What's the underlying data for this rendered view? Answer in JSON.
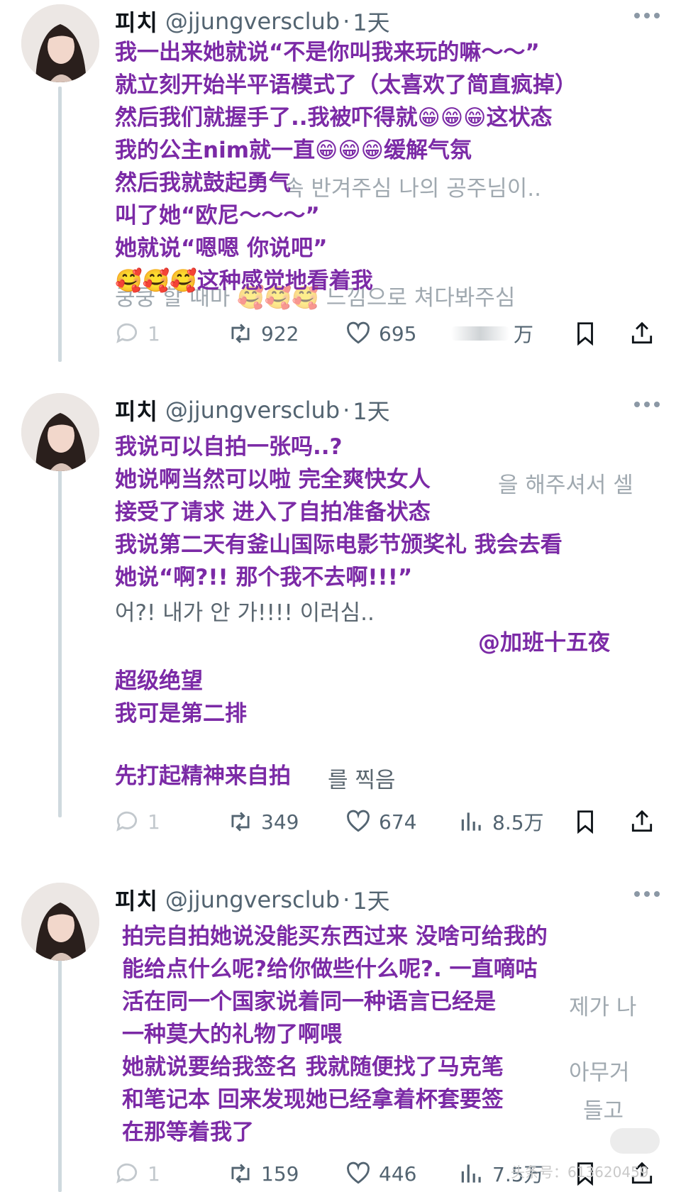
{
  "tweets": [
    {
      "name": "피치",
      "handle": "@jjungversclub",
      "time": "1天",
      "lines": [
        {
          "kr": "",
          "zh": "我一出来她就说“不是你叫我来玩的嘛～～”"
        },
        {
          "kr": "",
          "zh": "就立刻开始半平语模式了（太喜欢了简直疯掉）"
        },
        {
          "kr": "",
          "zh": "然后我们就握手了..我被吓得就😁😁😁这状态"
        },
        {
          "kr": "",
          "zh": "我的公主nim就一直😁😁😁缓解气氛"
        },
        {
          "kr": "속 반겨주심 나의 공주님이..",
          "zh": "然后我就鼓起勇气"
        },
        {
          "kr": "",
          "zh": "叫了她“欧尼～～～”"
        },
        {
          "kr": "",
          "zh": "她就说“嗯嗯 你说吧”"
        },
        {
          "kr": "쿵쿵 할 때마 🥰🥰🥰 느낌으로 쳐다봐주심",
          "zh": "🥰🥰🥰这种感觉地看着我"
        }
      ],
      "actions": {
        "replies": "1",
        "retweets": "922",
        "likes": "695",
        "views": "万"
      }
    },
    {
      "name": "피치",
      "handle": "@jjungversclub",
      "time": "1天",
      "lines": [
        {
          "kr": "",
          "zh": "我说可以自拍一张吗..?"
        },
        {
          "kr": "을 해주셔서 셀",
          "zh": "她说啊当然可以啦 完全爽快女人"
        },
        {
          "kr": "",
          "zh": "接受了请求 进入了自拍准备状态"
        },
        {
          "kr": "",
          "zh": "我说第二天有釜山国际电影节颁奖礼 我会去看"
        },
        {
          "kr": "",
          "zh": "她说“啊?!! 那个我不去啊!!!”"
        },
        {
          "kr_clear": "어?! 내가 안 가!!!! 이러심..",
          "zh": ""
        },
        {
          "kr": "",
          "zh": "",
          "zh_right": "@加班十五夜"
        },
        {
          "kr": "",
          "zh": "超级绝望"
        },
        {
          "kr": "",
          "zh": "我可是第二排"
        },
        {
          "kr": "",
          "zh": ""
        },
        {
          "kr": "",
          "zh": "先打起精神来自拍",
          "kr_after": "를 찍음"
        }
      ],
      "actions": {
        "replies": "1",
        "retweets": "349",
        "likes": "674",
        "views": "8.5万"
      }
    },
    {
      "name": "피치",
      "handle": "@jjungversclub",
      "time": "1天",
      "lines": [
        {
          "kr": "",
          "zh": "拍完自拍她说没能买东西过来 没啥可给我的"
        },
        {
          "kr": "",
          "zh": "能给点什么呢?给你做些什么呢?. 一直嘀咕"
        },
        {
          "kr": "제가 나",
          "zh": "活在同一个国家说着同一种语言已经是"
        },
        {
          "kr": "",
          "zh": "一种莫大的礼物了啊喂"
        },
        {
          "kr": "아무거",
          "zh": "她就说要给我签名 我就随便找了马克笔"
        },
        {
          "kr": "들고",
          "zh": "和笔记本 回来发现她已经拿着杯套要签"
        },
        {
          "kr": "",
          "zh": "在那等着我了"
        }
      ],
      "actions": {
        "replies": "1",
        "retweets": "159",
        "likes": "446",
        "views": "7.5万"
      }
    }
  ],
  "watermark": "头条号：613620459",
  "colors": {
    "chinese_text": "#7b2aa6",
    "muted": "#536471",
    "thread_line": "#cfd9de"
  },
  "icons": [
    "reply-icon",
    "retweet-icon",
    "like-icon",
    "views-icon",
    "bookmark-icon",
    "share-icon",
    "more-icon"
  ]
}
